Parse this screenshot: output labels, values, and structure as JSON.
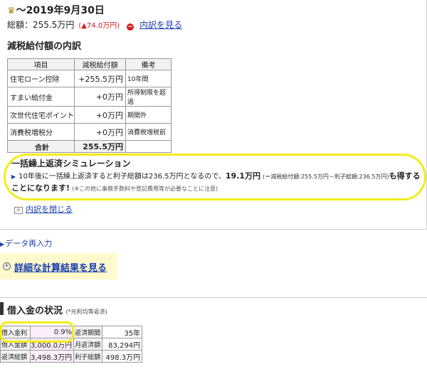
{
  "summary": {
    "period": "～2019年9月30日",
    "total_label": "総額：255.5万円",
    "total_change": "(▲74.0万円)",
    "breakdown_link": "内訳を見る"
  },
  "breakdown": {
    "title": "減税給付額の内訳",
    "headers": [
      "項目",
      "減税給付額",
      "備考"
    ],
    "rows": [
      {
        "item": "住宅ローン控除",
        "amount": "+255.5万円",
        "note": "10年間"
      },
      {
        "item": "すまい給付金",
        "amount": "+0万円",
        "note": "所得制限を超過"
      },
      {
        "item": "次世代住宅ポイント",
        "amount": "+0万円",
        "note": "期間外"
      },
      {
        "item": "消費税増税分",
        "amount": "+0万円",
        "note": "消費税増税前"
      }
    ],
    "sum_label": "合計",
    "sum_value": "255.5万円"
  },
  "simulation": {
    "title": "一括繰上返済シミュレーション",
    "text_1": "10年後に一括繰上返済すると利子総額は236.5万円となるので、",
    "gain": "19.1万円",
    "formula": "(＝減税給付額:255.5万円－利子総額:236.5万円)",
    "text_2": "も得することになります!",
    "note": "(※この他に事務手数料や登記費用等が必要なことに注意)"
  },
  "close_link": "内訳を閉じる",
  "reenter_link": "データ再入力",
  "detail_link": "詳細な計算結果を見る",
  "loan": {
    "title": "借入金の状況",
    "subtitle": "(*元利均等返済)",
    "rows": [
      {
        "label_1": "借入金利",
        "value_1": "0.9%",
        "label_2": "返済期間",
        "value_2": "35年"
      },
      {
        "label_1": "借入金額",
        "value_1": "3,000.0万円",
        "label_2": "月返済額",
        "value_2": "83,294円"
      },
      {
        "label_1": "返済総額",
        "value_1": "3,498.3万円",
        "label_2": "利子総額",
        "value_2": "498.3万円"
      }
    ]
  },
  "colors": {
    "link": "#1a3fb0",
    "negative": "#d02020",
    "highlight_ring": "#f2ec1a",
    "detail_bg": "#fff9cc"
  },
  "icons": [
    "crown-icon",
    "minus-circle-icon",
    "close-x-icon",
    "triangle-right-icon",
    "plus-circle-icon"
  ]
}
